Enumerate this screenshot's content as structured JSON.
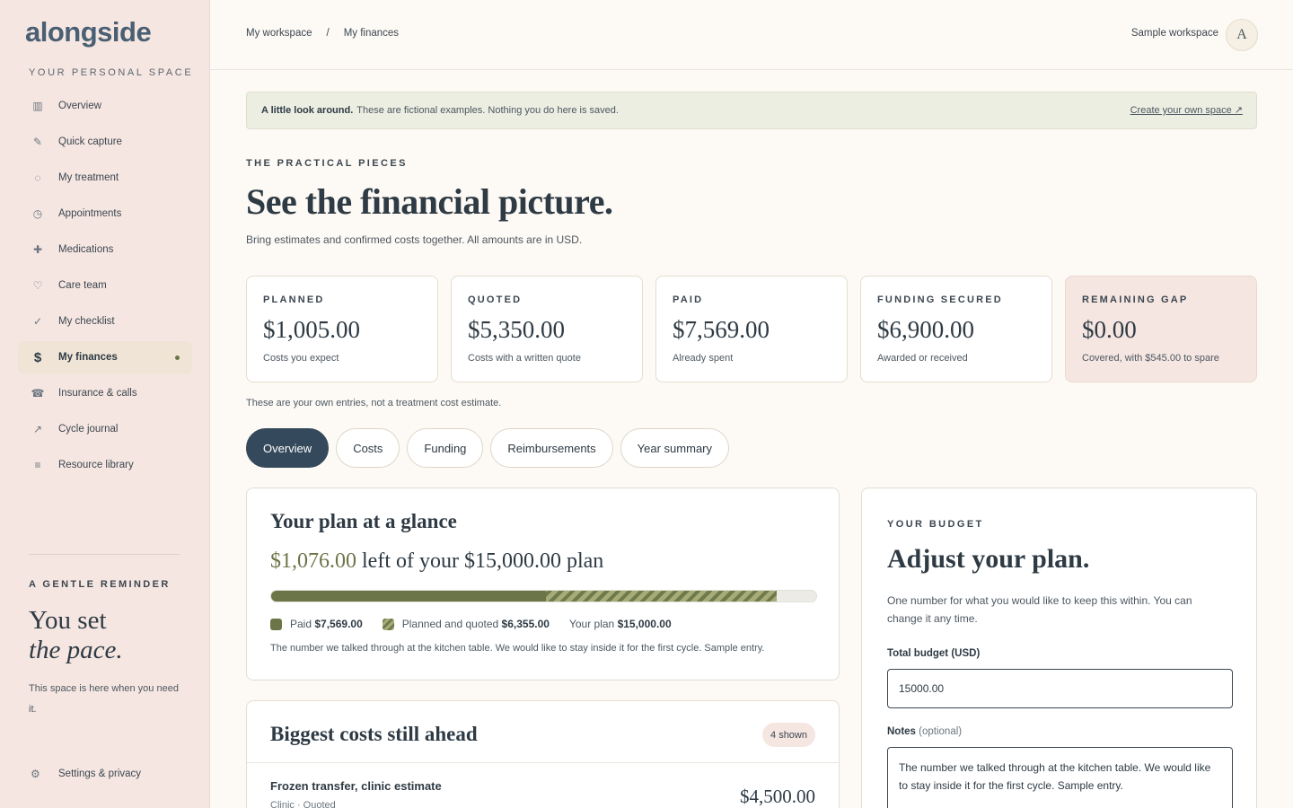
{
  "sidebar": {
    "logo": "alongside",
    "space_label": "YOUR PERSONAL SPACE",
    "items": [
      {
        "label": "Overview",
        "icon": "▥"
      },
      {
        "label": "Quick capture",
        "icon": "✎"
      },
      {
        "label": "My treatment",
        "icon": "◌"
      },
      {
        "label": "Appointments",
        "icon": "◷"
      },
      {
        "label": "Medications",
        "icon": "✚"
      },
      {
        "label": "Care team",
        "icon": "♡"
      },
      {
        "label": "My checklist",
        "icon": "✓"
      },
      {
        "label": "My finances",
        "icon": "$"
      },
      {
        "label": "Insurance & calls",
        "icon": "☎"
      },
      {
        "label": "Cycle journal",
        "icon": "↗"
      },
      {
        "label": "Resource library",
        "icon": "≡"
      }
    ],
    "reminder_label": "A GENTLE REMINDER",
    "reminder_line1": "You set",
    "reminder_line2": "the pace.",
    "reminder_body": "This space is here when you need it.",
    "settings_label": "Settings & privacy",
    "settings_icon": "⚙"
  },
  "topbar": {
    "crumb1": "My workspace",
    "crumb_sep": "/",
    "crumb2": "My finances",
    "workspace": "Sample workspace",
    "avatar": "A"
  },
  "notice": {
    "bold": "A little look around.",
    "text": "These are fictional examples. Nothing you do here is saved.",
    "link": "Create your own space ↗"
  },
  "header": {
    "eyebrow": "THE PRACTICAL PIECES",
    "title": "See the financial picture.",
    "subtitle": "Bring estimates and confirmed costs together. All amounts are in USD."
  },
  "stats": [
    {
      "label": "PLANNED",
      "value": "$1,005.00",
      "desc": "Costs you expect"
    },
    {
      "label": "QUOTED",
      "value": "$5,350.00",
      "desc": "Costs with a written quote"
    },
    {
      "label": "PAID",
      "value": "$7,569.00",
      "desc": "Already spent"
    },
    {
      "label": "FUNDING SECURED",
      "value": "$6,900.00",
      "desc": "Awarded or received"
    },
    {
      "label": "REMAINING GAP",
      "value": "$0.00",
      "desc": "Covered, with $545.00 to spare"
    }
  ],
  "stats_note": "These are your own entries, not a treatment cost estimate.",
  "tabs": [
    "Overview",
    "Costs",
    "Funding",
    "Reimbursements",
    "Year summary"
  ],
  "plan": {
    "title": "Your plan at a glance",
    "left_amount": "$1,076.00",
    "left_text": "left of your",
    "plan_amount": "$15,000.00",
    "plan_word": "plan",
    "paid_fraction": 0.5046,
    "planned_fraction": 0.4237,
    "legend_paid_label": "Paid",
    "legend_paid_value": "$7,569.00",
    "legend_planned_label": "Planned and quoted",
    "legend_planned_value": "$6,355.00",
    "legend_plan_label": "Your plan",
    "legend_plan_value": "$15,000.00",
    "note": "The number we talked through at the kitchen table. We would like to stay inside it for the first cycle. Sample entry."
  },
  "costs": {
    "title": "Biggest costs still ahead",
    "badge": "4 shown",
    "first_name": "Frozen transfer, clinic estimate",
    "first_meta": "Clinic · Quoted",
    "first_amount": "$4,500.00"
  },
  "budget": {
    "eyebrow": "YOUR BUDGET",
    "title": "Adjust your plan.",
    "desc": "One number for what you would like to keep this within. You can change it any time.",
    "total_label": "Total budget (USD)",
    "total_value": "15000.00",
    "notes_label": "Notes",
    "notes_optional": "(optional)",
    "notes_value": "The number we talked through at the kitchen table. We would like to stay inside it for the first cycle. Sample entry."
  }
}
